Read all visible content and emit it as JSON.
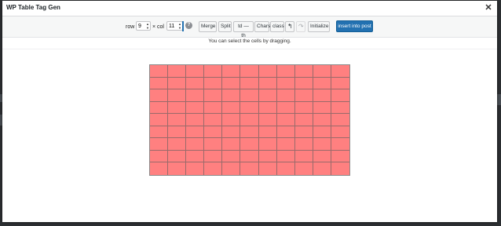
{
  "app": {
    "title": "WP Table Tag Gen"
  },
  "toolbar": {
    "row_label": "row",
    "row_value": "9",
    "times_col_label": "× col",
    "col_value": "11",
    "help_glyph": "?",
    "merge_label": "Merge",
    "split_label": "Split",
    "td_th_label": "td — th",
    "chars_label": "Chars",
    "class_label": "class",
    "undo_glyph": "↰",
    "redo_glyph": "↷",
    "initialize_label": "Initialize",
    "insert_label": "insert into post"
  },
  "hint": "You can select the cells by dragging.",
  "table": {
    "rows": 9,
    "cols": 11,
    "cell_color": "#ff8080"
  },
  "colors": {
    "primary": "#2271b1"
  }
}
